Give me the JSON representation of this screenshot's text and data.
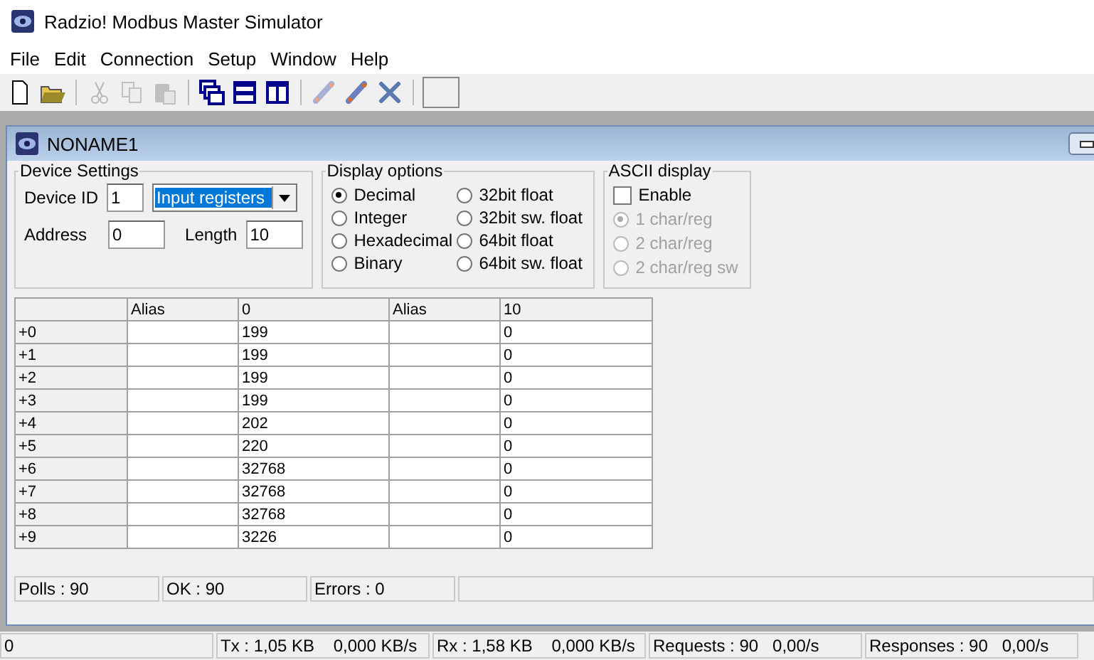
{
  "window": {
    "title": "Radzio! Modbus Master Simulator"
  },
  "menu": [
    "File",
    "Edit",
    "Connection",
    "Setup",
    "Window",
    "Help"
  ],
  "toolbar": [
    {
      "kind": "new",
      "disabled": false
    },
    {
      "kind": "open",
      "disabled": false
    },
    {
      "kind": "sep"
    },
    {
      "kind": "cut",
      "disabled": true
    },
    {
      "kind": "copy",
      "disabled": true
    },
    {
      "kind": "paste",
      "disabled": true
    },
    {
      "kind": "sep"
    },
    {
      "kind": "cascade",
      "disabled": false
    },
    {
      "kind": "tileh",
      "disabled": false
    },
    {
      "kind": "tilev",
      "disabled": false
    },
    {
      "kind": "sep"
    },
    {
      "kind": "connect",
      "disabled": true
    },
    {
      "kind": "connect2",
      "disabled": false
    },
    {
      "kind": "disconnect",
      "disabled": false
    },
    {
      "kind": "sep"
    },
    {
      "kind": "blank",
      "disabled": false
    }
  ],
  "child": {
    "title": "NONAME1",
    "device_settings": {
      "title": "Device Settings",
      "device_id_label": "Device ID",
      "device_id": "1",
      "function": "Input registers",
      "address_label": "Address",
      "address": "0",
      "length_label": "Length",
      "length": "10"
    },
    "display_options": {
      "title": "Display options",
      "options": [
        {
          "label": "Decimal",
          "selected": true
        },
        {
          "label": "Integer",
          "selected": false
        },
        {
          "label": "Hexadecimal",
          "selected": false
        },
        {
          "label": "Binary",
          "selected": false
        },
        {
          "label": "32bit float",
          "selected": false
        },
        {
          "label": "32bit sw. float",
          "selected": false
        },
        {
          "label": "64bit float",
          "selected": false
        },
        {
          "label": "64bit sw. float",
          "selected": false
        }
      ]
    },
    "ascii_display": {
      "title": "ASCII display",
      "enable_label": "Enable",
      "enable_checked": false,
      "options": [
        {
          "label": "1 char/reg",
          "selected": true,
          "disabled": true
        },
        {
          "label": "2 char/reg",
          "selected": false,
          "disabled": true
        },
        {
          "label": "2 char/reg sw",
          "selected": false,
          "disabled": true
        }
      ]
    },
    "table": {
      "columns": [
        "",
        "Alias",
        "0",
        "Alias",
        "10"
      ],
      "rows": [
        [
          "+0",
          "",
          "199",
          "",
          "0"
        ],
        [
          "+1",
          "",
          "199",
          "",
          "0"
        ],
        [
          "+2",
          "",
          "199",
          "",
          "0"
        ],
        [
          "+3",
          "",
          "199",
          "",
          "0"
        ],
        [
          "+4",
          "",
          "202",
          "",
          "0"
        ],
        [
          "+5",
          "",
          "220",
          "",
          "0"
        ],
        [
          "+6",
          "",
          "32768",
          "",
          "0"
        ],
        [
          "+7",
          "",
          "32768",
          "",
          "0"
        ],
        [
          "+8",
          "",
          "32768",
          "",
          "0"
        ],
        [
          "+9",
          "",
          "3226",
          "",
          "0"
        ]
      ]
    },
    "status_bar": [
      "Polls : 90",
      "OK : 90",
      "Errors : 0"
    ]
  },
  "status_bar": [
    "0",
    "Tx : 1,05 KB    0,000 KB/s",
    "Rx : 1,58 KB    0,000 KB/s",
    "Requests : 90   0,00/s",
    "Responses : 90   0,00/s"
  ]
}
